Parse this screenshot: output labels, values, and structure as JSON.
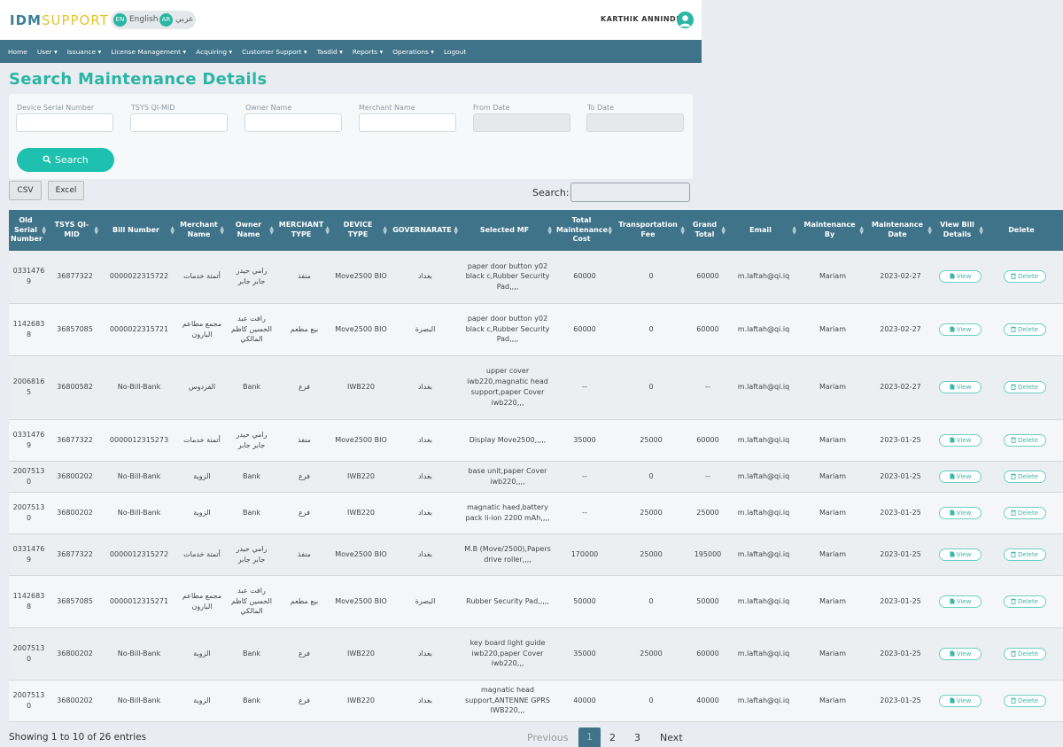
{
  "header": {
    "logo_part1": "IDM",
    "logo_part2": "SUPPORT",
    "lang_en_code": "EN",
    "lang_en_label": "English",
    "lang_ar_code": "AR",
    "lang_ar_label": "عربي",
    "user_name": "KARTHIK ANNINDLA"
  },
  "nav": {
    "items": [
      "Home",
      "User ▾",
      "Issuance ▾",
      "License Management ▾",
      "Acquiring ▾",
      "Customer Support ▾",
      "Tasdid ▾",
      "Reports ▾",
      "Operations ▾",
      "Logout"
    ]
  },
  "page": {
    "title": "Search Maintenance Details"
  },
  "form": {
    "labels": [
      "Device Serial Number",
      "TSYS QI-MID",
      "Owner Name",
      "Merchant Name",
      "From Date",
      "To Date"
    ],
    "search_label": "Search"
  },
  "table_tools": {
    "csv_label": "CSV",
    "excel_label": "Excel",
    "search_label": "Search:"
  },
  "table": {
    "columns": [
      "Old Serial Number",
      "TSYS QI-MID",
      "Bill Number",
      "Merchant Name",
      "Owner Name",
      "MERCHANT TYPE",
      "DEVICE TYPE",
      "GOVERNARATE",
      "Selected MF",
      "Total Maintenance Cost",
      "Transportation Fee",
      "Grand Total",
      "Email",
      "Maintenance By",
      "Maintenance Date",
      "View Bill Details",
      "Delete"
    ],
    "view_label": "View",
    "delete_label": "Delete",
    "rows": [
      [
        "03314769",
        "36877322",
        "0000022315722",
        "أتمتة خدمات",
        "رامي حيدر جابر جابر",
        "منفذ",
        "Move2500 BIO",
        "بغداد",
        "paper door button y02 black c,Rubber Security Pad,,,,",
        "60000",
        "0",
        "60000",
        "m.laftah@qi.iq",
        "Mariam",
        "2023-02-27"
      ],
      [
        "11426838",
        "36857085",
        "0000022315721",
        "مجمع مطاعم البارون",
        "رافت عبد الحسين كاظم المالكي",
        "بيع مطعم",
        "Move2500 BIO",
        "البصرة",
        "paper door button y02 black c,Rubber Security Pad,,,,",
        "60000",
        "0",
        "60000",
        "m.laftah@qi.iq",
        "Mariam",
        "2023-02-27"
      ],
      [
        "20068165",
        "36800582",
        "No-Bill-Bank",
        "الفردوس",
        "Bank",
        "فرع",
        "IWB220",
        "بغداد",
        "upper cover iwb220,magnatic head support,paper Cover iwb220,,,",
        "--",
        "0",
        "--",
        "m.laftah@qi.iq",
        "Mariam",
        "2023-02-27"
      ],
      [
        "03314769",
        "36877322",
        "0000012315273",
        "أتمتة خدمات",
        "رامي حيدر جابر جابر",
        "منفذ",
        "Move2500 BIO",
        "بغداد",
        "Display Move2500,,,,,",
        "35000",
        "25000",
        "60000",
        "m.laftah@qi.iq",
        "Mariam",
        "2023-01-25"
      ],
      [
        "20075130",
        "36800202",
        "No-Bill-Bank",
        "الزوية",
        "Bank",
        "فرع",
        "IWB220",
        "بغداد",
        "base unit,paper Cover iwb220,,,,",
        "--",
        "0",
        "--",
        "m.laftah@qi.iq",
        "Mariam",
        "2023-01-25"
      ],
      [
        "20075130",
        "36800202",
        "No-Bill-Bank",
        "الزوية",
        "Bank",
        "فرع",
        "IWB220",
        "بغداد",
        "magnatic haed,battery pack li-ion 2200 mAh,,,,",
        "--",
        "25000",
        "25000",
        "m.laftah@qi.iq",
        "Mariam",
        "2023-01-25"
      ],
      [
        "03314769",
        "36877322",
        "0000012315272",
        "أتمتة خدمات",
        "رامي حيدر جابر جابر",
        "منفذ",
        "Move2500 BIO",
        "بغداد",
        "M.B (Move/2500),Papers drive roller,,,,",
        "170000",
        "25000",
        "195000",
        "m.laftah@qi.iq",
        "Mariam",
        "2023-01-25"
      ],
      [
        "11426838",
        "36857085",
        "0000012315271",
        "مجمع مطاعم البارون",
        "رافت عبد الحسين كاظم المالكي",
        "بيع مطعم",
        "Move2500 BIO",
        "البصرة",
        "Rubber Security Pad,,,,,",
        "50000",
        "0",
        "50000",
        "m.laftah@qi.iq",
        "Mariam",
        "2023-01-25"
      ],
      [
        "20075130",
        "36800202",
        "No-Bill-Bank",
        "الزوية",
        "Bank",
        "فرع",
        "IWB220",
        "بغداد",
        "key board light guide iwb220,paper Cover iwb220,,,",
        "35000",
        "25000",
        "60000",
        "m.laftah@qi.iq",
        "Mariam",
        "2023-01-25"
      ],
      [
        "20075130",
        "36800202",
        "No-Bill-Bank",
        "الزوية",
        "Bank",
        "فرع",
        "IWB220",
        "بغداد",
        "magnatic head support,ANTENNE GPRS IWB220,,,",
        "40000",
        "0",
        "40000",
        "m.laftah@qi.iq",
        "Mariam",
        "2023-01-25"
      ]
    ]
  },
  "footer": {
    "entries_text": "Showing 1 to 10 of 26 entries",
    "prev_label": "Previous",
    "pages": [
      "1",
      "2",
      "3"
    ],
    "next_label": "Next"
  },
  "colors": {
    "accent": "#2ab5a5",
    "nav_bg": "#3f7389",
    "logo_yellow": "#e3c32a"
  },
  "icons": {
    "search_button": "search-icon",
    "view_button": "file-icon",
    "delete_button": "trash-icon",
    "sort": "sort-icon",
    "user": "user-avatar-icon"
  }
}
